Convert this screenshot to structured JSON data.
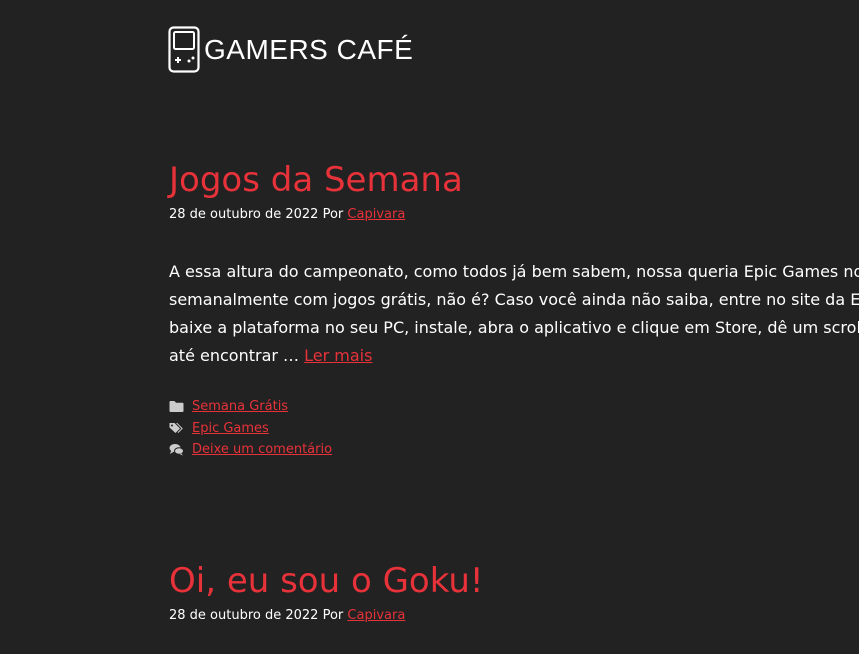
{
  "site": {
    "brand": "GAMERS CAFÉ"
  },
  "posts": [
    {
      "title": "Jogos da Semana",
      "date": "28 de outubro de 2022",
      "by": "Por",
      "author": "Capivara",
      "excerpt_lines": [
        "A essa altura do campeonato, como todos já bem sabem, nossa queria Epic Games nos prese",
        "semanalmente com jogos grátis, não é? Caso você ainda não saiba, entre no site da Epic Gam",
        "baixe a plataforma no seu PC, instale, abra o aplicativo e clique em Store, dê um scroll pra ba",
        "até encontrar …"
      ],
      "read_more": "Ler mais",
      "category": "Semana Grátis",
      "tag": "Epic Games",
      "comment": "Deixe um comentário"
    },
    {
      "title": "Oi, eu sou o Goku!",
      "date": "28 de outubro de 2022",
      "by": "Por",
      "author": "Capivara"
    }
  ],
  "colors": {
    "background": "#222222",
    "accent": "#e8323a",
    "text": "#ffffff",
    "icon": "#cccccc"
  }
}
